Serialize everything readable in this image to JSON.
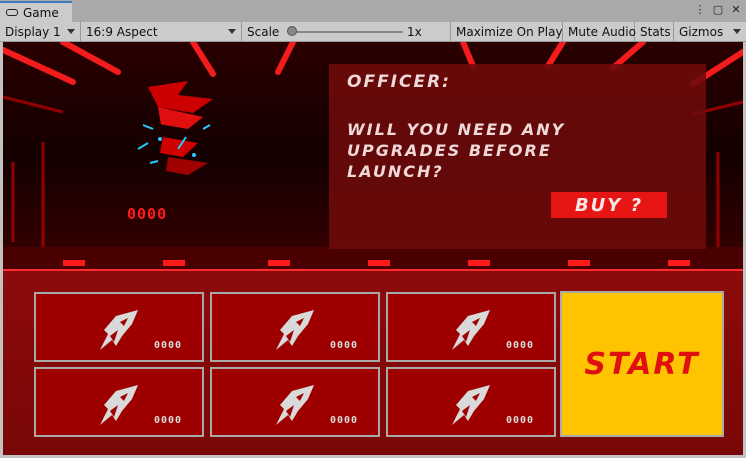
{
  "editor": {
    "tab_label": "Game",
    "window_buttons": [
      "⋮",
      "▢",
      "✕"
    ],
    "toolbar": {
      "display": "Display 1",
      "aspect": "16:9 Aspect",
      "scale_label": "Scale",
      "scale_value": "1x",
      "maximize": "Maximize On Play",
      "mute": "Mute Audio",
      "stats": "Stats",
      "gizmos": "Gizmos"
    }
  },
  "hud": {
    "score": "0000"
  },
  "dialog": {
    "speaker": "OFFICER:",
    "line1": "WILL YOU NEED ANY",
    "line2": "UPGRADES BEFORE",
    "line3": "LAUNCH?",
    "buy_label": "BUY ?"
  },
  "upgrades": [
    {
      "cost": "0000",
      "icon": "rocket-upgrade-icon"
    },
    {
      "cost": "0000",
      "icon": "rocket-upgrade-icon"
    },
    {
      "cost": "0000",
      "icon": "rocket-upgrade-icon"
    },
    {
      "cost": "0000",
      "icon": "rocket-upgrade-icon"
    },
    {
      "cost": "0000",
      "icon": "rocket-upgrade-icon"
    },
    {
      "cost": "0000",
      "icon": "rocket-upgrade-icon"
    }
  ],
  "start_label": "START",
  "colors": {
    "scene_red": "#ff1a1a",
    "panel_red": "#9e0000",
    "buy_red": "#e81515",
    "start_yellow": "#ffc400",
    "start_text": "#e01010"
  }
}
